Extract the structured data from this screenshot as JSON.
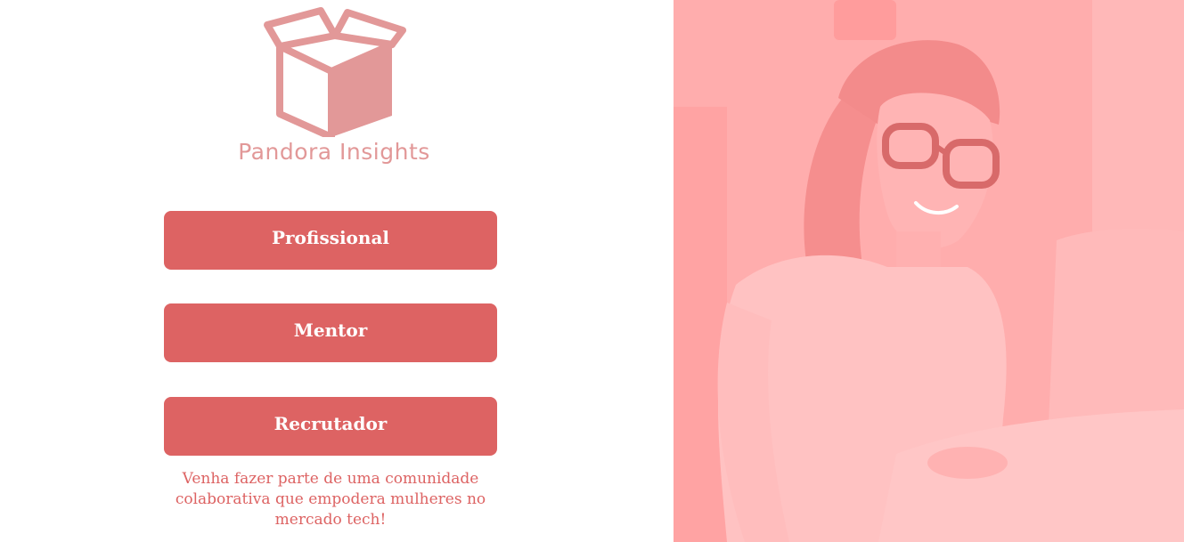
{
  "brand": {
    "name": "Pandora Insights",
    "logo_icon": "open-box-icon",
    "color": "#e29898"
  },
  "roles": [
    {
      "label": "Profissional"
    },
    {
      "label": "Mentor"
    },
    {
      "label": "Recrutador"
    }
  ],
  "tagline": "Venha fazer parte de uma comunidade colaborativa que empodera mulheres no mercado tech!",
  "hero": {
    "image": "woman-at-laptop-photo",
    "tint": "#ff9f9f"
  },
  "accent_color": "#dd6363"
}
